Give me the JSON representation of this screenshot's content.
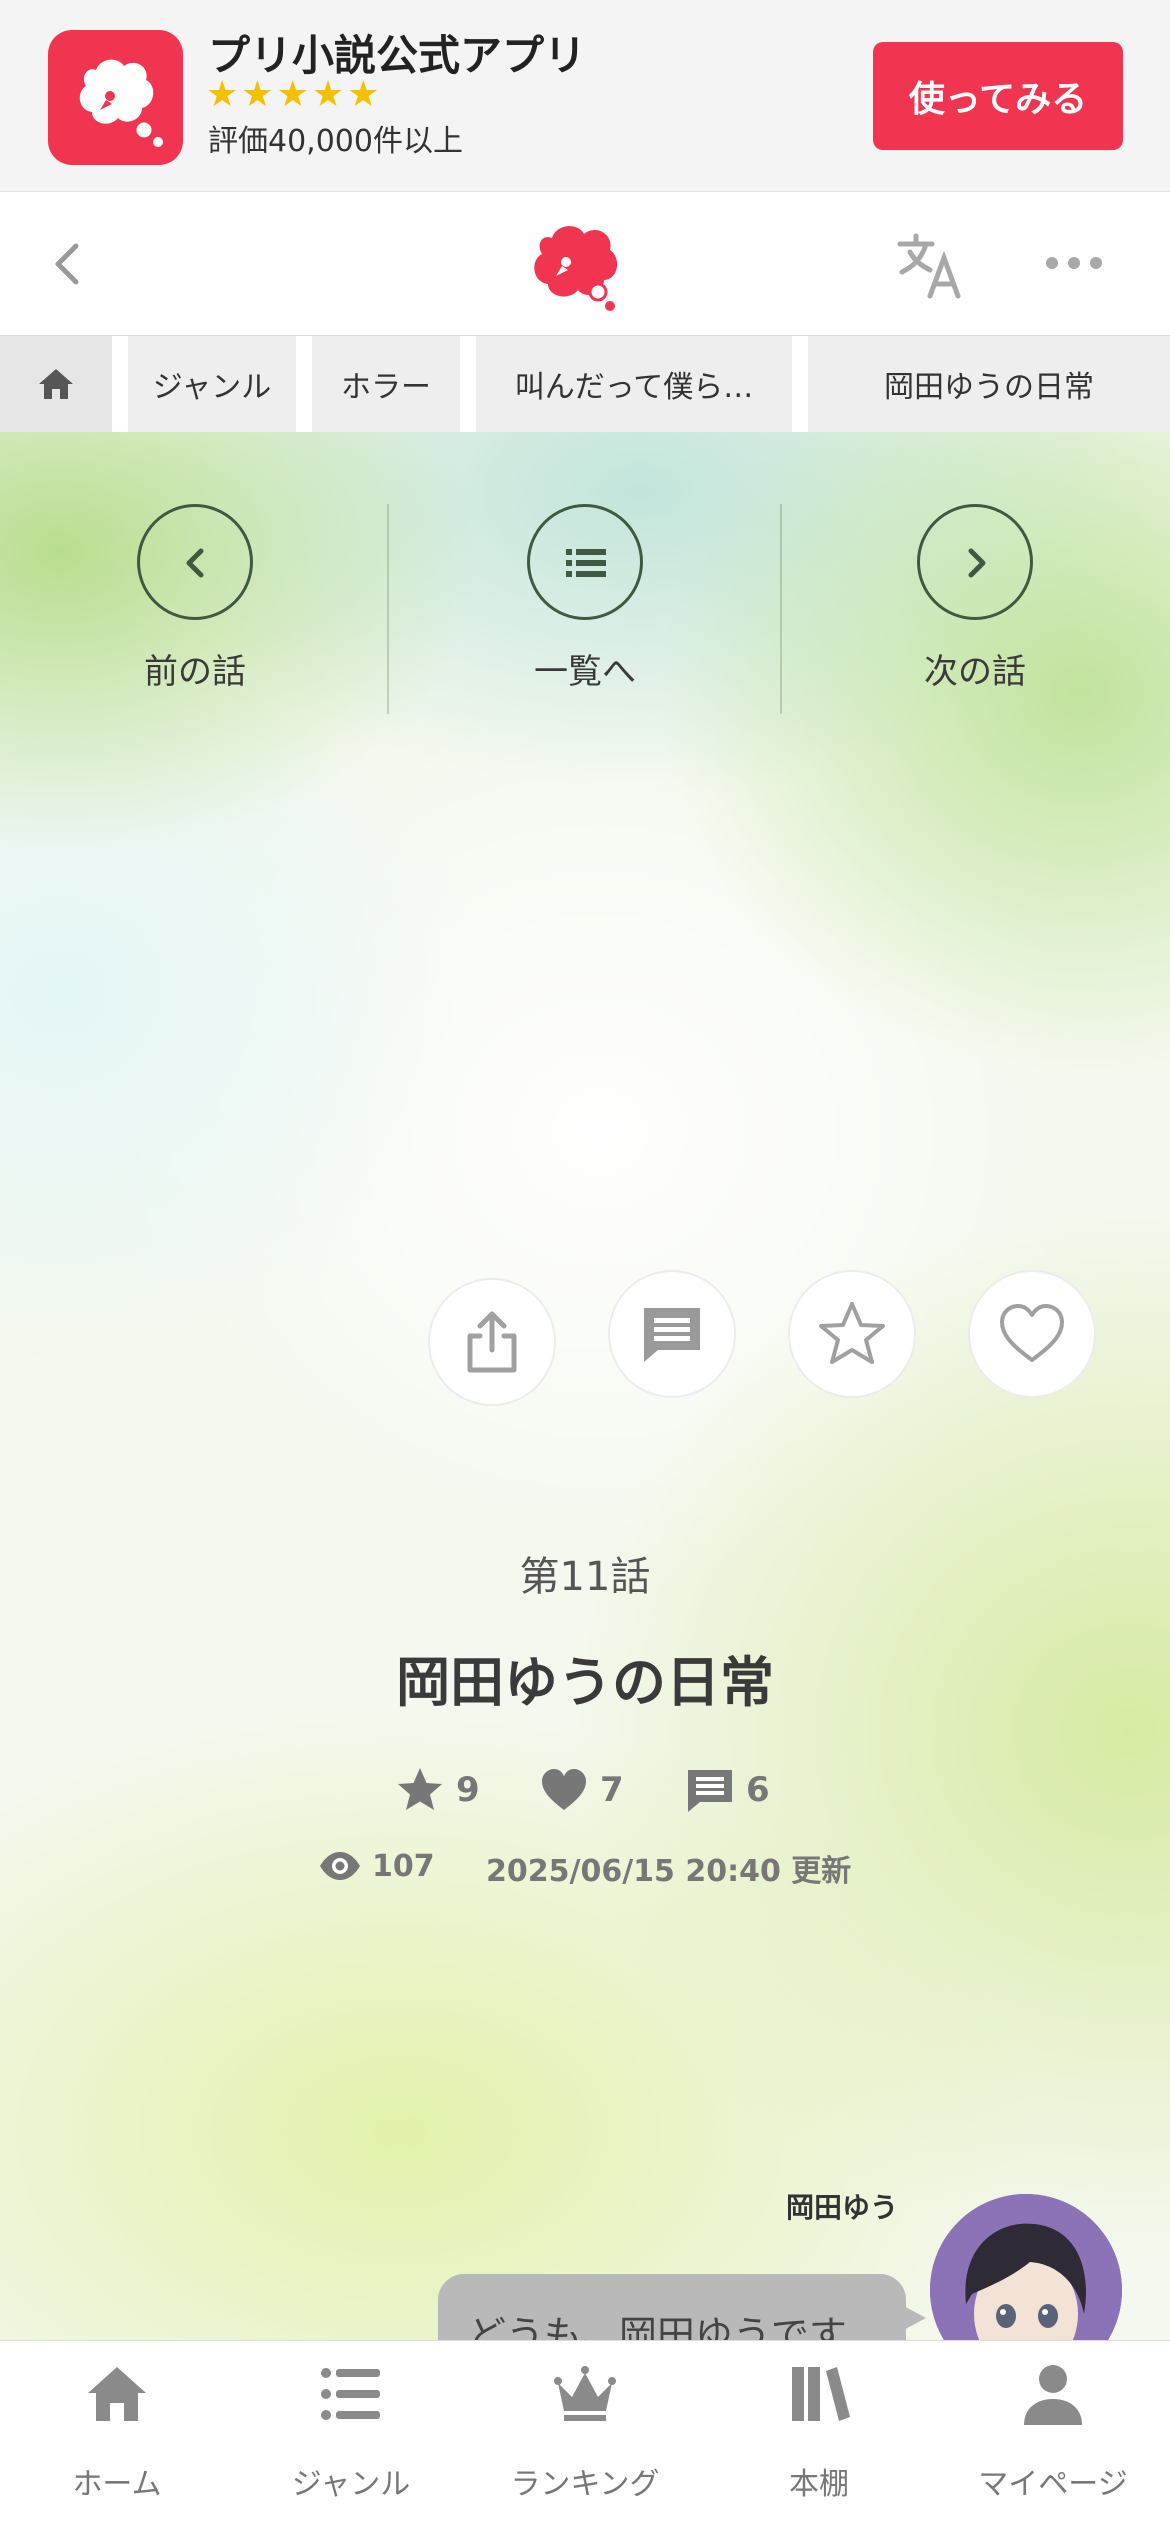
{
  "app_banner": {
    "title": "プリ小説公式アプリ",
    "stars": 5,
    "rating_text": "評価40,000件以上",
    "cta_label": "使ってみる",
    "brand_color": "#f1344f"
  },
  "header": {
    "icons": [
      "back-icon",
      "logo-icon",
      "translate-icon",
      "more-icon"
    ]
  },
  "breadcrumb": {
    "items": [
      "ジャンル",
      "ホラー",
      "叫んだって僕ら…",
      "岡田ゆうの日常"
    ]
  },
  "episode_nav": {
    "prev_label": "前の話",
    "list_label": "一覧へ",
    "next_label": "次の話"
  },
  "actions": [
    "share-icon",
    "comment-icon",
    "star-icon",
    "heart-icon"
  ],
  "episode": {
    "number": "第11話",
    "title": "岡田ゆうの日常",
    "stars": "9",
    "likes": "7",
    "comments": "6",
    "views": "107",
    "updated": "2025/06/15 20:40 更新"
  },
  "chat": {
    "speaker": "岡田ゆう",
    "message": "どうも、岡田ゆうです"
  },
  "bottom_nav": {
    "items": [
      {
        "label": "ホーム",
        "icon": "home-icon"
      },
      {
        "label": "ジャンル",
        "icon": "list-icon"
      },
      {
        "label": "ランキング",
        "icon": "crown-icon"
      },
      {
        "label": "本棚",
        "icon": "bookshelf-icon"
      },
      {
        "label": "マイページ",
        "icon": "person-icon"
      }
    ]
  }
}
